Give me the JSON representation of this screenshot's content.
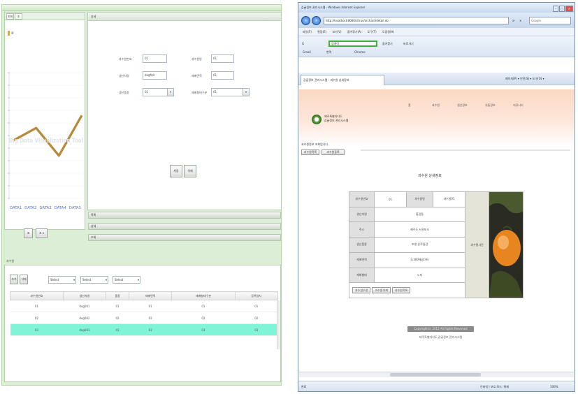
{
  "left_app": {
    "chart_tabs": [
      "조회",
      "조"
    ],
    "chart_legend": "귤",
    "chart_watermark": "Big Data Visualization Tool",
    "chart_x_labels": [
      "DATA1",
      "DATA2",
      "DATA3",
      "DATA4",
      "DATA5"
    ],
    "chart_series": [
      4.6,
      5.6,
      3.4,
      6.6
    ],
    "chart_buttons": [
      "조",
      "조 ▾"
    ],
    "form_header": "상세",
    "form_fields": [
      {
        "label": "과수원번호",
        "value": "01"
      },
      {
        "label": "과수원명",
        "value": "01"
      },
      {
        "label": "생산자명",
        "value": "dogfish"
      },
      {
        "label": "재배면적",
        "value": "01"
      },
      {
        "label": "생산품종",
        "value": "01"
      },
      {
        "label": "재배형태구분",
        "value": "01"
      }
    ],
    "form_buttons": [
      "저장",
      "삭제"
    ],
    "accordion_bars": [
      "목록",
      "상세",
      "조회"
    ],
    "grid_label": "과수원",
    "grid_buttons": [
      "추가",
      "삭제"
    ],
    "grid_selects": [
      "Select",
      "Select",
      "Select"
    ],
    "grid_columns": [
      "과수원번호",
      "생산자명",
      "품종",
      "재배면적",
      "재배형태구분",
      "등록일자"
    ],
    "grid_rows": [
      [
        "01",
        "dog001",
        "01",
        "01",
        "01",
        "01"
      ],
      [
        "02",
        "dog002",
        "02",
        "02",
        "02",
        "02"
      ],
      [
        "03",
        "dog003",
        "03",
        "03",
        "03",
        "03"
      ]
    ],
    "grid_selected_row": 2
  },
  "browser": {
    "title": "감귤정보 관리시스템 - Windows Internet Explorer",
    "address": "http://localhost:8080/citrus/orchard/detail.do",
    "search_placeholder": "Google",
    "menu": [
      "파일(F)",
      "편집(E)",
      "보기(V)",
      "즐겨찾기(A)",
      "도구(T)",
      "도움말(H)"
    ],
    "toolbar_search": "검색어",
    "toolbar_items": [
      "즐겨찾기",
      "바로가기",
      "Gmail",
      "번역",
      "Chrome"
    ],
    "tab_label": "감귤정보 관리시스템 - 과수원 상세정보",
    "page_tools": "페이지(P) ▾  안전(S) ▾  도구(O) ▾",
    "logo_lines": [
      "제주특별자치도",
      "감귤정보 관리시스템"
    ],
    "top_nav": [
      "홈",
      "과수원",
      "생산정보",
      "유통정보",
      "커뮤니티"
    ],
    "page_note": "과수원정보 조회입니다.",
    "page_buttons": [
      "과수원목록",
      "과수원등록"
    ],
    "detail_title": "과수원 상세정보",
    "detail": {
      "no_label": "과수원번호",
      "no_value": "01",
      "name_label": "과수원명",
      "name_value": "과수원01",
      "owner_label": "생산자명",
      "owner_value": "홍길동",
      "addr_label": "주소",
      "addr_value": "제주도 서귀포시",
      "variety_label": "생산품종",
      "variety_value": "조생 온주밀감",
      "area_label": "재배면적",
      "area_value": "3,300제곱미터",
      "type_label": "재배형태",
      "type_value": "노지",
      "photo_label": "과수원사진"
    },
    "detail_buttons": [
      "과수원수정",
      "과수원삭제",
      "과수원목록"
    ],
    "footer_bar": "Copyright(c) 2012 All Rights Reserved",
    "footer_text": "제주특별자치도 감귤정보 관리시스템",
    "status_left": "완료",
    "status_zone": "인터넷 | 보호 모드: 해제",
    "status_zoom": "100%"
  },
  "colors": {
    "left_bg": "#dcefd6",
    "chart_line": "#b7893b",
    "grid_selected": "#7ff4d6",
    "header_peach": "#fbd8c4",
    "ie_accent": "#2f6cc0"
  }
}
